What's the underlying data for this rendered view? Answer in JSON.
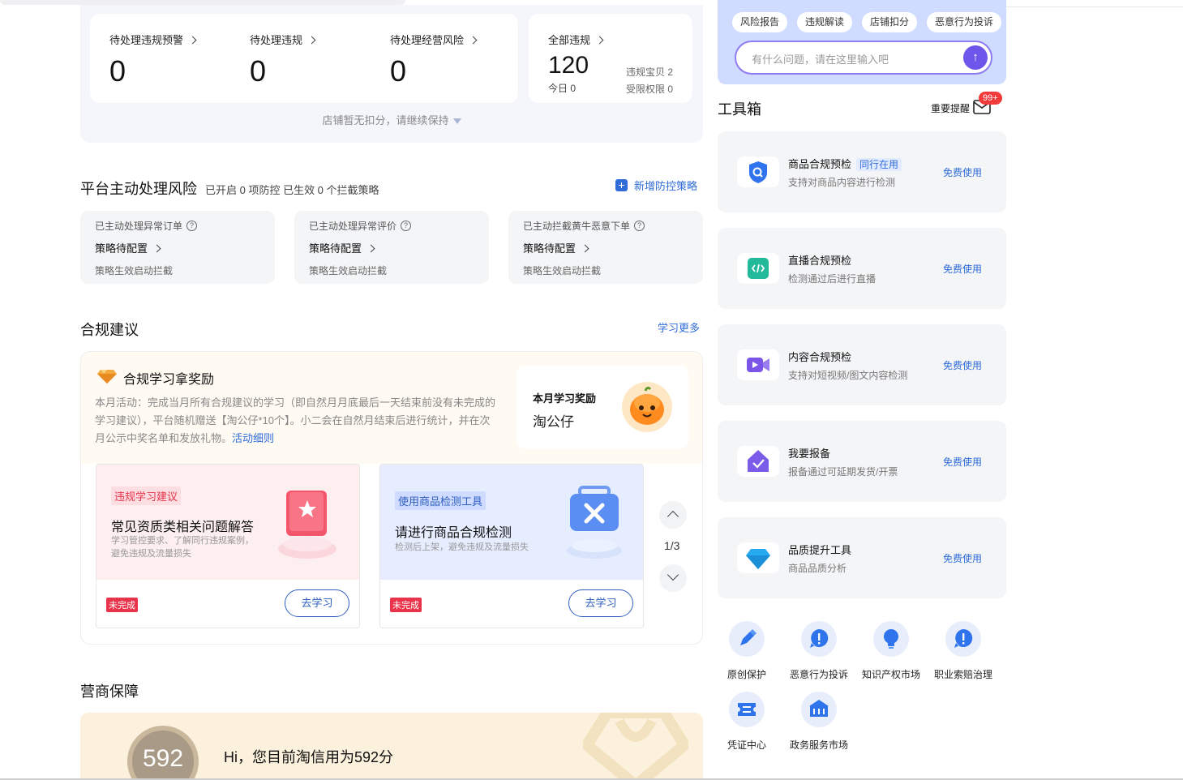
{
  "top_stats": {
    "items": [
      {
        "label": "待处理违规预警",
        "value": "0"
      },
      {
        "label": "待处理违规",
        "value": "0"
      },
      {
        "label": "待处理经营风险",
        "value": "0"
      }
    ],
    "all_violations": {
      "label": "全部违规",
      "value": "120",
      "today_label": "今日",
      "today_value": "0",
      "baby_label": "违规宝贝",
      "baby_value": "2",
      "limited_label": "受限权限",
      "limited_value": "0"
    },
    "note": "店铺暂无扣分，请继续保持"
  },
  "platform_risk": {
    "title": "平台主动处理风险",
    "subtitle": "已开启 0 项防控 已生效 0 个拦截策略",
    "add_link": "新增防控策略",
    "cards": [
      {
        "title": "已主动处理异常订单",
        "status": "策略待配置",
        "note": "策略生效启动拦截"
      },
      {
        "title": "已主动处理异常评价",
        "status": "策略待配置",
        "note": "策略生效启动拦截"
      },
      {
        "title": "已主动拦截黄牛恶意下单",
        "status": "策略待配置",
        "note": "策略生效启动拦截"
      }
    ]
  },
  "compliance": {
    "title": "合规建议",
    "more_link": "学习更多",
    "reward_title": "合规学习拿奖励",
    "reward_desc": "本月活动：完成当月所有合规建议的学习（即自然月月底最后一天结束前没有未完成的学习建议），平台随机赠送【淘公仔*10个】。小二会在自然月结束后进行统计，并在次月公示中奖名单和发放礼物。",
    "reward_link": "活动细则",
    "monthly_label": "本月学习奖励",
    "monthly_prize": "淘公仔",
    "cards": [
      {
        "tag": "违规学习建议",
        "title": "常见资质类相关问题解答",
        "desc": "学习管控要求、了解同行违规案例，避免违规及流量损失",
        "status": "未完成",
        "button": "去学习"
      },
      {
        "tag": "使用商品检测工具",
        "title": "请进行商品合规检测",
        "desc": "检测后上架，避免违规及流量损失",
        "status": "未完成",
        "button": "去学习"
      }
    ],
    "pager": "1/3"
  },
  "guarantee": {
    "title": "营商保障",
    "score": "592",
    "message": "Hi，您目前淘信用为592分"
  },
  "assistant": {
    "chips": [
      "风险报告",
      "违规解读",
      "店铺扣分",
      "恶意行为投诉"
    ],
    "placeholder": "有什么问题，请在这里输入吧"
  },
  "toolbox": {
    "title": "工具箱",
    "reminder_label": "重要提醒",
    "reminder_badge": "99+",
    "tools": [
      {
        "title": "商品合规预检",
        "tag": "同行在用",
        "desc": "支持对商品内容进行检测",
        "action": "免费使用",
        "icon": "shield-search-icon"
      },
      {
        "title": "直播合规预检",
        "tag": "",
        "desc": "检测通过后进行直播",
        "action": "免费使用",
        "icon": "code-icon"
      },
      {
        "title": "内容合规预检",
        "tag": "",
        "desc": "支持对短视频/图文内容检测",
        "action": "免费使用",
        "icon": "video-icon"
      },
      {
        "title": "我要报备",
        "tag": "",
        "desc": "报备通过可延期发货/开票",
        "action": "免费使用",
        "icon": "check-house-icon"
      },
      {
        "title": "品质提升工具",
        "tag": "",
        "desc": "商品品质分析",
        "action": "免费使用",
        "icon": "diamond-icon"
      }
    ],
    "quick": [
      {
        "label": "原创保护",
        "icon": "pen-icon"
      },
      {
        "label": "恶意行为投诉",
        "icon": "alert-icon"
      },
      {
        "label": "知识产权市场",
        "icon": "bulb-icon"
      },
      {
        "label": "职业索赔治理",
        "icon": "alert-icon"
      },
      {
        "label": "凭证中心",
        "icon": "ticket-icon"
      },
      {
        "label": "政务服务市场",
        "icon": "bank-icon"
      }
    ]
  },
  "colors": {
    "accent": "#2f6bd9",
    "purple": "#6d56e9",
    "danger": "#e8334a"
  }
}
